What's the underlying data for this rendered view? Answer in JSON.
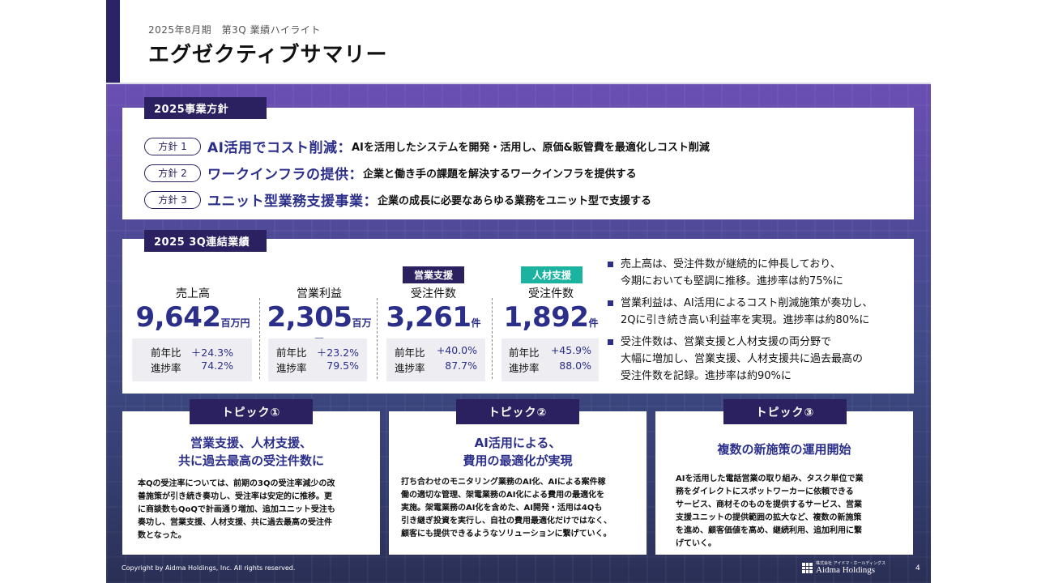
{
  "header": {
    "subtitle": "2025年8月期　第3Q 業績ハイライト",
    "title": "エグゼクティブサマリー"
  },
  "policy": {
    "tab": "2025事業方針",
    "items": [
      {
        "pill": "方針 1",
        "title": "AI活用でコスト削減：",
        "desc": "AIを活用したシステムを開発・活用し、原価&販管費を最適化しコスト削減"
      },
      {
        "pill": "方針 2",
        "title": "ワークインフラの提供：",
        "desc": "企業と働き手の課題を解決するワークインフラを提供する"
      },
      {
        "pill": "方針 3",
        "title": "ユニット型業務支援事業：",
        "desc": "企業の成長に必要なあらゆる業務をユニット型で支援する"
      }
    ]
  },
  "results": {
    "tab": "2025 3Q連結業績",
    "kpis": [
      {
        "label": "売上高",
        "value": "9,642",
        "unit": "百万円",
        "yoy_label": "前年比",
        "yoy": "＋24.3%",
        "progress_label": "進捗率",
        "progress": "74.2%"
      },
      {
        "label": "営業利益",
        "value": "2,305",
        "unit": "百万円",
        "yoy_label": "前年比",
        "yoy": "＋23.2%",
        "progress_label": "進捗率",
        "progress": "79.5%"
      },
      {
        "badge": "営業支援",
        "badge_color": "#2b2160",
        "label": "受注件数",
        "value": "3,261",
        "unit": "件",
        "yoy_label": "前年比",
        "yoy": "+40.0%",
        "progress_label": "進捗率",
        "progress": "87.7%"
      },
      {
        "badge": "人材支援",
        "badge_color": "#1bb3a0",
        "label": "受注件数",
        "value": "1,892",
        "unit": "件",
        "yoy_label": "前年比",
        "yoy": "+45.9%",
        "progress_label": "進捗率",
        "progress": "88.0%"
      }
    ],
    "bullets": [
      {
        "line1": "売上高は、受注件数が継続的に伸長しており、",
        "line2": "今期においても堅調に推移。進捗率は約75%に"
      },
      {
        "line1": "営業利益は、AI活用によるコスト削減施策が奏功し、",
        "line2": "2Qに引き続き高い利益率を実現。進捗率は約80%に"
      },
      {
        "line1": "受注件数は、営業支援と人材支援の両分野で",
        "line2": "大幅に増加し、営業支援、人材支援共に過去最高の",
        "line3": "受注件数を記録。進捗率は約90%に"
      }
    ]
  },
  "topics": [
    {
      "tab": "トピック①",
      "head1": "営業支援、人材支援、",
      "head2": "共に過去最高の受注件数に",
      "body": [
        "本Qの受注率については、前期の3Qの受注率減少の改",
        "善施策が引き続き奏功し、受注率は安定的に推移。更",
        "に商談数もQoQで計画通り増加、追加ユニット受注も",
        "奏功し、営業支援、人材支援、共に過去最高の受注件",
        "数となった。"
      ]
    },
    {
      "tab": "トピック②",
      "head1": "AI活用による、",
      "head2": "費用の最適化が実現",
      "body": [
        "打ち合わせのモニタリング業務のAI化、AIによる案件稼",
        "働の適切な管理、架電業務のAI化による費用の最適化を",
        "実施。架電業務のAI化を含めた、AI開発・活用は4Qも",
        "引き継ぎ投資を実行し、自社の費用最適化だけではなく、",
        "顧客にも提供できるようなソリューションに繋げていく。"
      ]
    },
    {
      "tab": "トピック③",
      "head1": "複数の新施策の運用開始",
      "head2": "",
      "body": [
        "AIを活用した電話営業の取り組み、タスク単位で業",
        "務をダイレクトにスポットワーカーに依頼できる",
        "サービス、商材そのものを提供するサービス、営業",
        "支援ユニットの提供範囲の拡大など、複数の新施策",
        "を進め、顧客価値を高め、継続利用、追加利用に繋",
        "げていく。"
      ]
    }
  ],
  "footer": {
    "copyright": "Copyright by Aidma Holdings, Inc. All rights reserved.",
    "logo_small": "株式会社 アイドマ・ホールディングス",
    "logo_text": "Aidma Holdings",
    "page": "4"
  }
}
